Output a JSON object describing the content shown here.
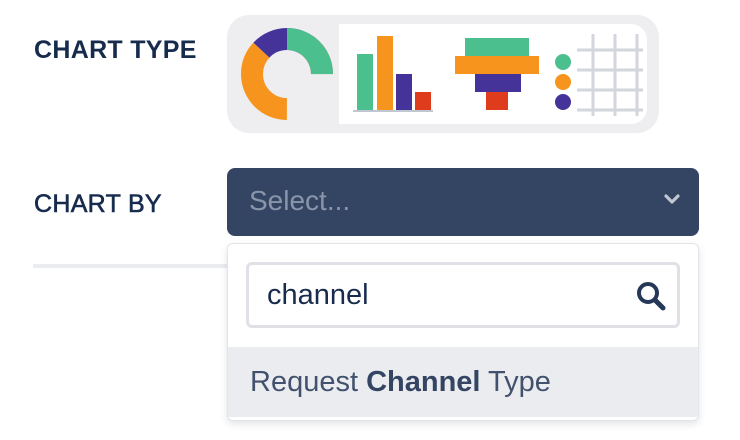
{
  "chart_type": {
    "label": "CHART TYPE",
    "options": [
      {
        "icon": "donut-chart-icon",
        "selected": true
      },
      {
        "icon": "bar-chart-icon",
        "selected": false
      },
      {
        "icon": "funnel-chart-icon",
        "selected": false
      },
      {
        "icon": "table-chart-icon",
        "selected": false
      }
    ]
  },
  "chart_by": {
    "label": "CHART BY",
    "placeholder": "Select...",
    "chevron_icon": "chevron-down-icon"
  },
  "dropdown": {
    "search_value": "channel",
    "search_icon": "search-icon",
    "options": [
      {
        "before": "Request ",
        "match": "Channel",
        "after": " Type"
      }
    ]
  },
  "colors": {
    "label_text": "#172b4d",
    "select_bg": "#344563",
    "placeholder": "#8a95aa",
    "green": "#4bc08e",
    "orange": "#f7941d",
    "purple": "#45339a",
    "red": "#de3c1c",
    "option_hover": "#ebecf0"
  }
}
